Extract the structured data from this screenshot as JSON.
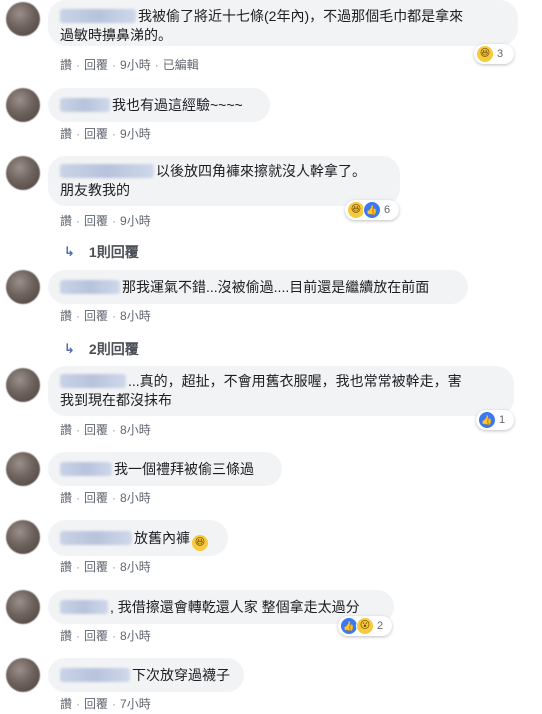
{
  "actions": {
    "like": "讚",
    "reply": "回覆",
    "dot": "·"
  },
  "comments": [
    {
      "text": "我被偷了將近十七條(2年內)，不過那個毛巾都是拿來\n過敏時擤鼻涕的。",
      "time": "9小時",
      "edited": "已編輯",
      "reactions": {
        "icons": [
          "haha-icon"
        ],
        "count": "3"
      }
    },
    {
      "text": "我也有過這經驗~~~~",
      "time": "9小時"
    },
    {
      "text": "以後放四角褲來擦就沒人幹拿了。\n朋友教我的",
      "time": "9小時",
      "reactions": {
        "icons": [
          "haha-icon",
          "like-icon"
        ],
        "count": "6"
      }
    },
    {
      "text": "那我運氣不錯...沒被偷過....目前還是繼續放在前面",
      "time": "8小時"
    },
    {
      "text": "...真的，超扯，不會用舊衣服喔，我也常常被幹走，害\n我到現在都沒抹布",
      "time": "8小時",
      "reactions": {
        "icons": [
          "like-icon"
        ],
        "count": "1"
      }
    },
    {
      "text": "我一個禮拜被偷三條過",
      "time": "8小時"
    },
    {
      "text": "放舊內褲",
      "time": "8小時"
    },
    {
      "text": ", 我借擦還會轉乾還人家 整個拿走太過分",
      "time": "8小時",
      "reactions": {
        "icons": [
          "like-icon",
          "wow-icon"
        ],
        "count": "2"
      }
    },
    {
      "text": "下次放穿過襪子",
      "time": "7小時"
    }
  ],
  "replies": [
    {
      "label": "1則回覆"
    },
    {
      "label": "2則回覆"
    }
  ]
}
